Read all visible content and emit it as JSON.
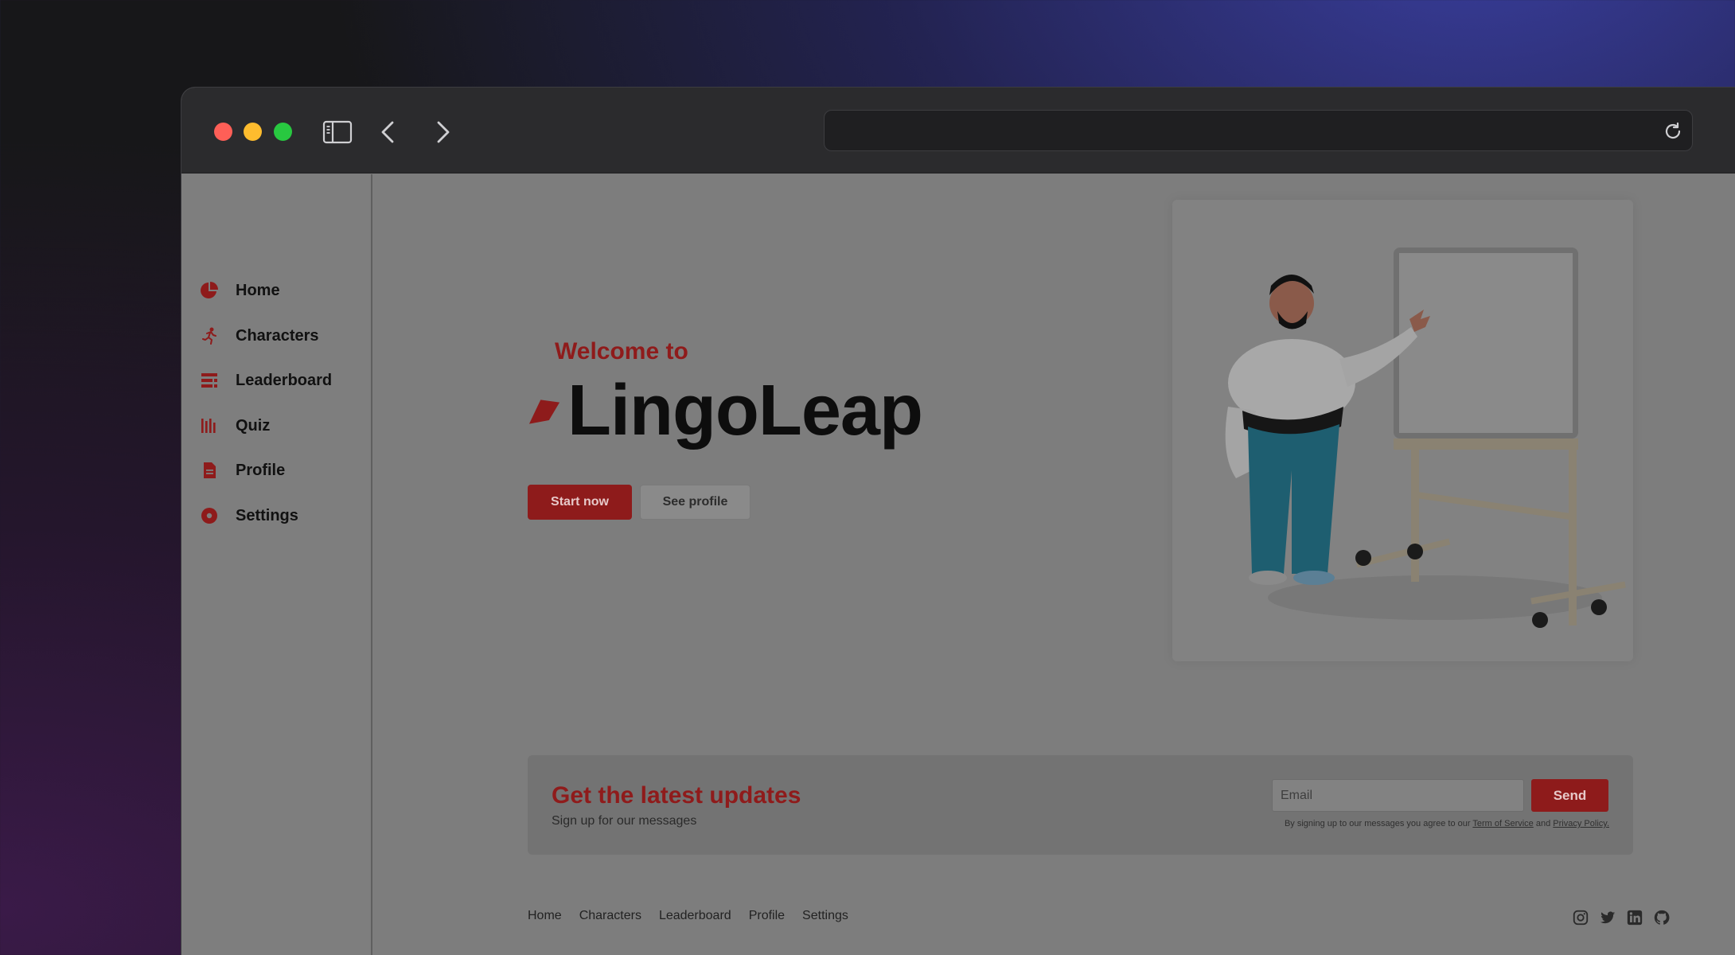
{
  "window": {
    "url": "",
    "traffic_lights": [
      "close",
      "minimize",
      "zoom"
    ],
    "toolbar_icons": [
      "sidebar-toggle-icon",
      "back-icon",
      "forward-icon",
      "reload-icon"
    ]
  },
  "sidebar": {
    "items": [
      {
        "label": "Home",
        "icon": "pie-chart-icon"
      },
      {
        "label": "Characters",
        "icon": "running-figure-icon"
      },
      {
        "label": "Leaderboard",
        "icon": "list-icon"
      },
      {
        "label": "Quiz",
        "icon": "bars-icon"
      },
      {
        "label": "Profile",
        "icon": "document-icon"
      },
      {
        "label": "Settings",
        "icon": "circle-dot-icon"
      }
    ]
  },
  "hero": {
    "welcome": "Welcome to",
    "brand": "LingoLeap",
    "start_button": "Start now",
    "profile_button": "See profile",
    "illustration": "man-presenting-at-whiteboard"
  },
  "newsletter": {
    "title": "Get the latest updates",
    "subtitle": "Sign up for our messages",
    "email_placeholder": "Email",
    "send_button": "Send",
    "legal_prefix": "By signing up to our messages you agree to our",
    "terms_link": "Term of Service",
    "legal_and": "and",
    "privacy_link": "Privacy Policy."
  },
  "footer": {
    "links": [
      "Home",
      "Characters",
      "Leaderboard",
      "Profile",
      "Settings"
    ],
    "socials": [
      "instagram-icon",
      "twitter-icon",
      "linkedin-icon",
      "github-icon"
    ]
  },
  "colors": {
    "accent": "#8e1b1b",
    "overlay_gray": "#7d7d7d",
    "titlebar": "#2b2b2d"
  }
}
